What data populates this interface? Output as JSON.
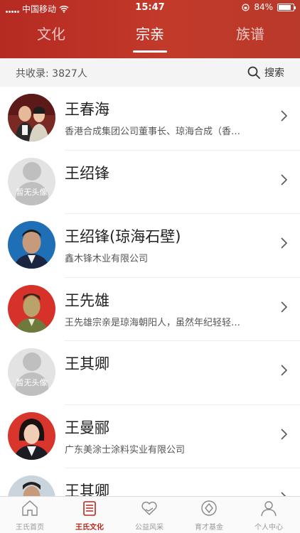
{
  "status": {
    "carrier": "中国移动",
    "time": "15:47",
    "battery": "84%",
    "battery_level": 0.84
  },
  "tabs": [
    {
      "label": "文化",
      "active": false
    },
    {
      "label": "宗亲",
      "active": true
    },
    {
      "label": "族谱",
      "active": false
    }
  ],
  "subbar": {
    "count": "共收录: 3827人",
    "search_label": "搜索"
  },
  "list": [
    {
      "name": "王春海",
      "desc": "香港合成集团公司董事长、琼海合成（香…",
      "avatar": "photo-couple"
    },
    {
      "name": "王绍锋",
      "desc": "",
      "avatar": "placeholder",
      "placeholder_text": "暂无头像"
    },
    {
      "name": "王绍锋(琼海石壁)",
      "desc": "鑫木锋木业有限公司",
      "avatar": "photo-man-blue"
    },
    {
      "name": "王先雄",
      "desc": "王先雄宗亲是琼海朝阳人，虽然年纪轻轻…",
      "avatar": "photo-man-red"
    },
    {
      "name": "王其卿",
      "desc": "",
      "avatar": "placeholder",
      "placeholder_text": "暂无头像"
    },
    {
      "name": "王曼郦",
      "desc": "广东美涂士涂料实业有限公司",
      "avatar": "photo-woman-red"
    },
    {
      "name": "王其卿",
      "desc": "",
      "avatar": "photo-man-partial"
    }
  ],
  "tabbar": [
    {
      "label": "王氏首页",
      "icon": "home-icon",
      "active": false
    },
    {
      "label": "王氏文化",
      "icon": "culture-icon",
      "active": true
    },
    {
      "label": "公益风采",
      "icon": "charity-icon",
      "active": false
    },
    {
      "label": "育才基金",
      "icon": "fund-icon",
      "active": false
    },
    {
      "label": "个人中心",
      "icon": "person-icon",
      "active": false
    }
  ],
  "colors": {
    "brand": "#b52a22",
    "active_tab": "#b8291f"
  }
}
